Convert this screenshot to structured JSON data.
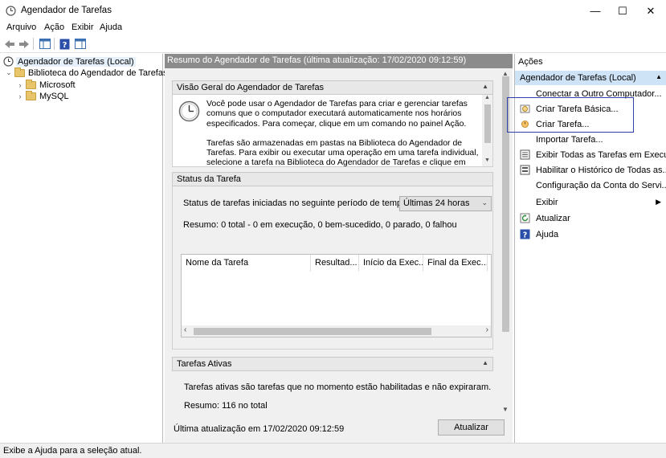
{
  "window": {
    "title": "Agendador de Tarefas"
  },
  "menu": [
    "Arquivo",
    "Ação",
    "Exibir",
    "Ajuda"
  ],
  "tree": {
    "root": "Agendador de Tarefas (Local)",
    "library": "Biblioteca do Agendador de Tarefas",
    "children": [
      "Microsoft",
      "MySQL"
    ]
  },
  "center": {
    "header": "Resumo do Agendador de Tarefas (última atualização: 17/02/2020 09:12:59)",
    "overview": {
      "title": "Visão Geral do Agendador de Tarefas",
      "p1": "Você pode usar o Agendador de Tarefas para criar e gerenciar tarefas comuns que o computador executará automaticamente nos horários especificados. Para começar, clique em um comando no painel Ação.",
      "p2": "Tarefas são armazenadas em pastas na Biblioteca do Agendador de Tarefas. Para exibir ou executar uma operação em uma tarefa individual, selecione a tarefa na Biblioteca do Agendador de Tarefas e clique em um comando no"
    },
    "status": {
      "title": "Status da Tarefa",
      "period_label": "Status de tarefas iniciadas no seguinte período de tempo:",
      "period_value": "Últimas 24 horas",
      "summary": "Resumo: 0 total - 0 em execução, 0 bem-sucedido, 0 parado, 0 falhou",
      "columns": [
        "Nome da Tarefa",
        "Resultad...",
        "Início da Exec...",
        "Final da Exec..."
      ]
    },
    "active": {
      "title": "Tarefas Ativas",
      "desc": "Tarefas ativas são tarefas que no momento estão habilitadas e não expiraram.",
      "summary": "Resumo: 116 no total"
    },
    "last_update": "Última atualização em 17/02/2020 09:12:59",
    "refresh_button": "Atualizar"
  },
  "actions": {
    "title": "Ações",
    "group": "Agendador de Tarefas (Local)",
    "items": [
      "Conectar a Outro Computador...",
      "Criar Tarefa Básica...",
      "Criar Tarefa...",
      "Importar Tarefa...",
      "Exibir Todas as Tarefas em Execu...",
      "Habilitar o Histórico de Todas as...",
      "Configuração da Conta do Servi...",
      "Exibir",
      "Atualizar",
      "Ajuda"
    ]
  },
  "statusbar": "Exibe a Ajuda para a seleção atual."
}
